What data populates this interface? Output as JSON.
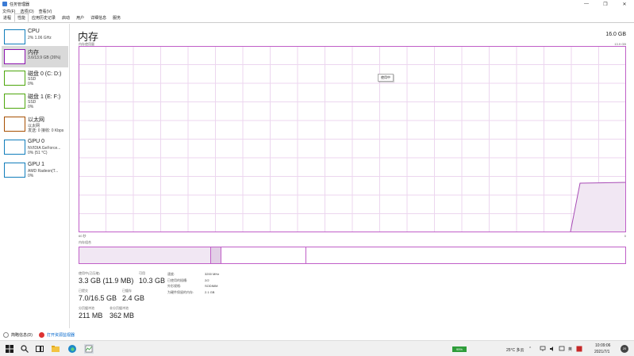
{
  "window": {
    "title": "任务管理器",
    "minimize": "—",
    "maximize": "❐",
    "close": "✕"
  },
  "menu": [
    "文件(F)",
    "选项(O)",
    "查看(V)"
  ],
  "tabs": [
    "进程",
    "性能",
    "应用历史记录",
    "启动",
    "用户",
    "详细信息",
    "服务"
  ],
  "active_tab": 1,
  "sidebar": [
    {
      "name": "CPU",
      "sub": "2% 1.06 GHz",
      "sub2": "",
      "color": "#117dbb"
    },
    {
      "name": "内存",
      "sub": "3.6/13.9 GB (26%)",
      "sub2": "",
      "color": "#8b12ae"
    },
    {
      "name": "磁盘 0 (C: D:)",
      "sub": "SSD",
      "sub2": "0%",
      "color": "#4da60c"
    },
    {
      "name": "磁盘 1 (E: F:)",
      "sub": "SSD",
      "sub2": "0%",
      "color": "#4da60c"
    },
    {
      "name": "以太网",
      "sub": "以太网",
      "sub2": "发送: 0 接收: 0 Kbps",
      "color": "#a74f01"
    },
    {
      "name": "GPU 0",
      "sub": "NVIDIA GeForce...",
      "sub2": "0% (51 °C)",
      "color": "#117dbb"
    },
    {
      "name": "GPU 1",
      "sub": "AMD Radeon(T...",
      "sub2": "0%",
      "color": "#117dbb"
    }
  ],
  "main": {
    "title": "内存",
    "total": "16.0 GB",
    "chart_label_left": "内存使用量",
    "chart_label_right": "13.9 GB",
    "axis_left": "60 秒",
    "axis_right": "0",
    "tooltip": "使用中",
    "composition_label": "内存组合",
    "accent": "#c05fc8"
  },
  "stats": {
    "in_use_label": "使用中(已压缩)",
    "in_use": "3.3 GB (11.9 MB)",
    "available_label": "可用",
    "available": "10.3 GB",
    "committed_label": "已提交",
    "committed": "7.0/16.5 GB",
    "cached_label": "已缓存",
    "cached": "2.4 GB",
    "paged_label": "分页缓冲池",
    "paged": "211 MB",
    "nonpaged_label": "非分页缓冲池",
    "nonpaged": "362 MB"
  },
  "details": {
    "labels": [
      "速度:",
      "已使用的插槽:",
      "外形规格:",
      "为硬件保留的内存:"
    ],
    "values": [
      "3200 MHz",
      "2/2",
      "SODIMM",
      "2.1 GB"
    ]
  },
  "footer": {
    "summary": "简略信息(D)",
    "open_monitor": "打开资源监视器"
  },
  "taskbar": {
    "battery": "95%",
    "weather": "25°C 多云",
    "ime": "英",
    "time": "10:09:06",
    "date": "2021/7/1",
    "notification_count": "20"
  }
}
